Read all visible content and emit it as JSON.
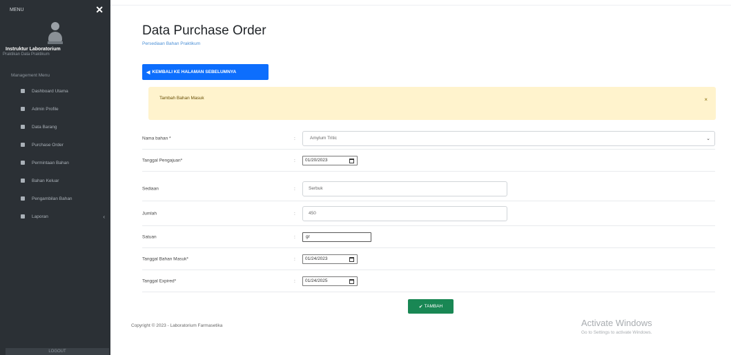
{
  "sidebar": {
    "header_label": "MENU",
    "close_symbol": "✕",
    "user_name": "Instruktur Laboratorium",
    "user_role": "Praktikan Data Praktikum",
    "section_title": "Management Menu",
    "items": [
      {
        "label": "Dashboard Utama",
        "icon": "dashboard-icon"
      },
      {
        "label": "Admin Profile",
        "icon": "user-icon"
      },
      {
        "label": "Data Barang",
        "icon": "box-icon"
      },
      {
        "label": "Purchase Order",
        "icon": "cart-icon"
      },
      {
        "label": "Permintaan Bahan",
        "icon": "request-icon"
      },
      {
        "label": "Bahan Keluar",
        "icon": "export-icon"
      },
      {
        "label": "Pengambilan Bahan",
        "icon": "take-icon"
      },
      {
        "label": "Laporan",
        "icon": "report-icon",
        "has_submenu": true
      }
    ],
    "footer_label": "LOGOUT"
  },
  "main": {
    "title": "Data Purchase Order",
    "subtitle": "Persediaan Bahan Praktikum",
    "back_button": "KEMBALI KE HALAMAN SEBELUMNYA",
    "alert": {
      "text": "Tambah Bahan Masuk",
      "close_symbol": "×"
    },
    "form": {
      "nama_bahan": {
        "label": "Nama bahan *",
        "value": "Amylum Tritic"
      },
      "tanggal_pengajuan": {
        "label": "Tanggal Pengajuan*",
        "value": "01/20/2023"
      },
      "sediaan": {
        "label": "Sediaan",
        "value": "Serbuk"
      },
      "jumlah": {
        "label": "Jumlah",
        "value": "450"
      },
      "satuan": {
        "label": "Satuan",
        "value": "gr"
      },
      "tanggal_masuk": {
        "label": "Tanggal Bahan Masuk*",
        "value": "01/24/2023"
      },
      "tanggal_expired": {
        "label": "Tanggal Expired*",
        "value": "01/24/2025"
      }
    },
    "colon": ":",
    "add_button": "TAMBAH",
    "copyright": "Copyright © 2023 - Laboratorium Farmasetika"
  },
  "watermark": {
    "title": "Activate Windows",
    "subtitle": "Go to Settings to activate Windows."
  },
  "colors": {
    "sidebar_bg": "#2b3035",
    "primary": "#0d6efd",
    "success": "#198754",
    "alert_bg": "#fff3cd"
  }
}
